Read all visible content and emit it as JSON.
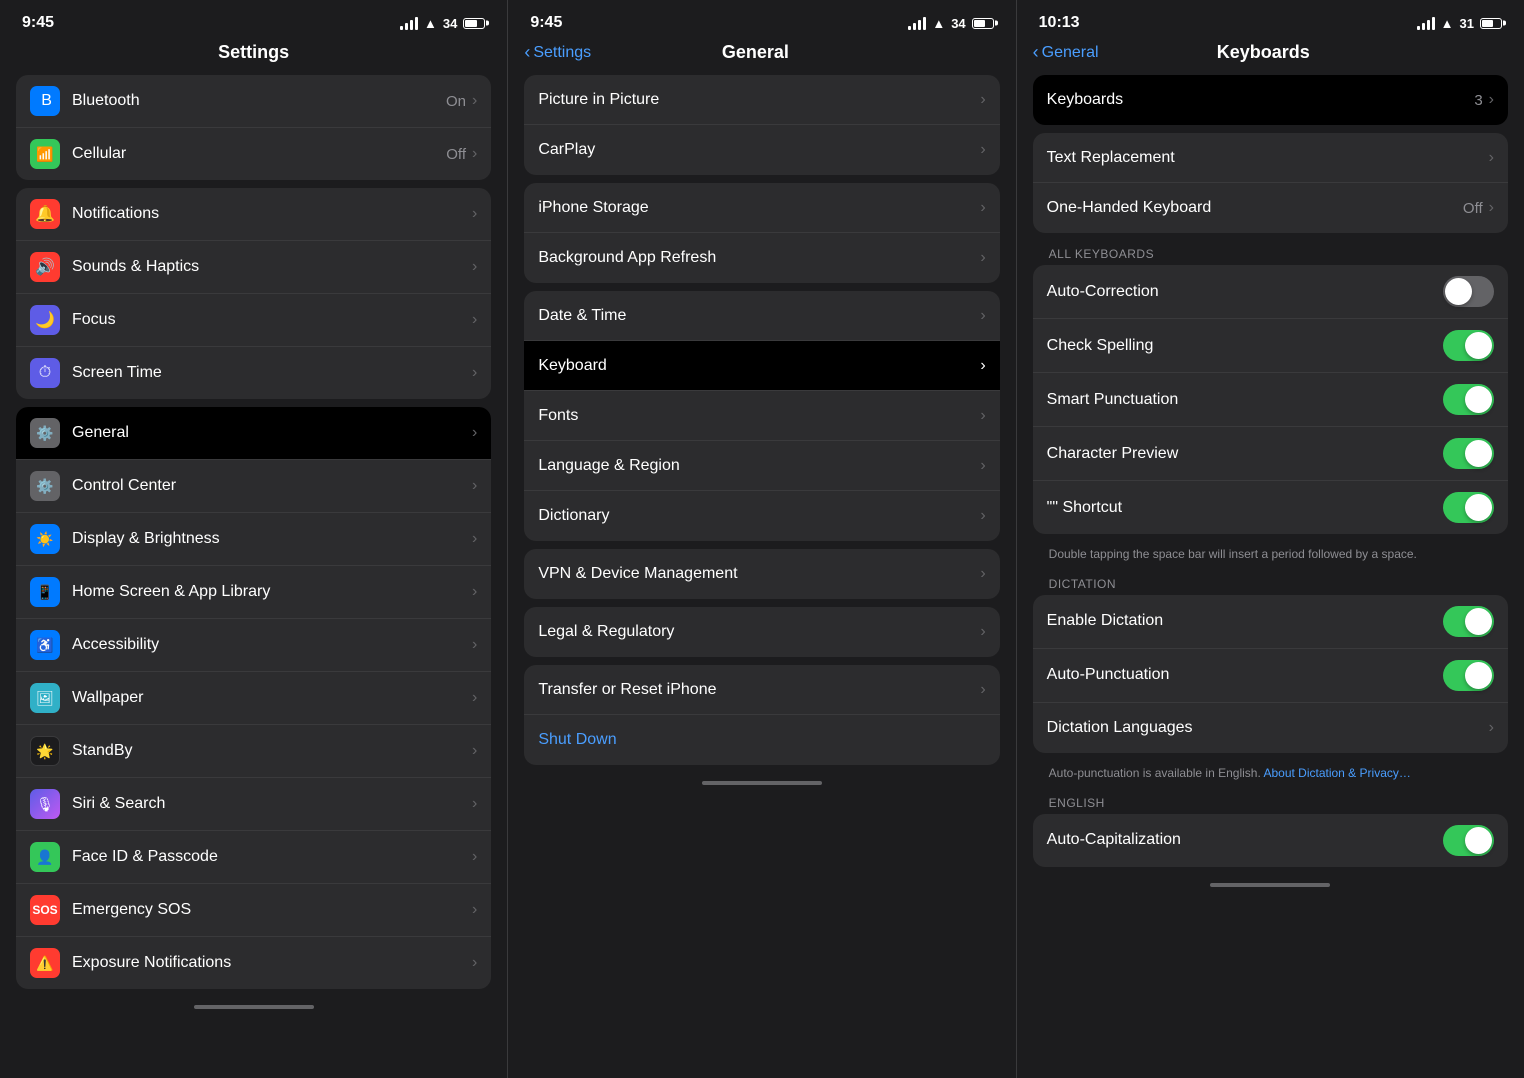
{
  "panels": [
    {
      "id": "settings",
      "statusBar": {
        "time": "9:45",
        "battery": "34"
      },
      "navTitle": "Settings",
      "groups": [
        {
          "items": [
            {
              "icon": "🔵",
              "iconBg": "icon-blue",
              "label": "Bluetooth",
              "value": "On",
              "chevron": true
            },
            {
              "icon": "📶",
              "iconBg": "icon-green",
              "label": "Cellular",
              "value": "Off",
              "chevron": true
            }
          ]
        },
        {
          "items": [
            {
              "icon": "🔔",
              "iconBg": "icon-red",
              "label": "Notifications",
              "value": "",
              "chevron": true
            },
            {
              "icon": "🔊",
              "iconBg": "icon-red",
              "label": "Sounds & Haptics",
              "value": "",
              "chevron": true
            },
            {
              "icon": "🌙",
              "iconBg": "icon-purple",
              "label": "Focus",
              "value": "",
              "chevron": true
            },
            {
              "icon": "⏱",
              "iconBg": "icon-purple",
              "label": "Screen Time",
              "value": "",
              "chevron": true
            }
          ]
        },
        {
          "items": [
            {
              "icon": "⚙️",
              "iconBg": "icon-gray",
              "label": "General",
              "value": "",
              "chevron": true,
              "selected": true
            },
            {
              "icon": "⚙️",
              "iconBg": "icon-gray",
              "label": "Control Center",
              "value": "",
              "chevron": true
            },
            {
              "icon": "☀️",
              "iconBg": "icon-blue",
              "label": "Display & Brightness",
              "value": "",
              "chevron": true
            },
            {
              "icon": "📱",
              "iconBg": "icon-blue",
              "label": "Home Screen & App Library",
              "value": "",
              "chevron": true
            },
            {
              "icon": "♿",
              "iconBg": "icon-blue",
              "label": "Accessibility",
              "value": "",
              "chevron": true
            },
            {
              "icon": "🖼",
              "iconBg": "icon-teal",
              "label": "Wallpaper",
              "value": "",
              "chevron": true
            },
            {
              "icon": "⏱",
              "iconBg": "icon-dark",
              "label": "StandBy",
              "value": "",
              "chevron": true
            },
            {
              "icon": "🎙",
              "iconBg": "icon-gradient-siri",
              "label": "Siri & Search",
              "value": "",
              "chevron": true
            },
            {
              "icon": "👤",
              "iconBg": "icon-green",
              "label": "Face ID & Passcode",
              "value": "",
              "chevron": true
            },
            {
              "icon": "🆘",
              "iconBg": "icon-red",
              "label": "Emergency SOS",
              "value": "",
              "chevron": true
            },
            {
              "icon": "⚠️",
              "iconBg": "icon-red",
              "label": "Exposure Notifications",
              "value": "",
              "chevron": true
            }
          ]
        }
      ]
    },
    {
      "id": "general",
      "statusBar": {
        "time": "9:45",
        "battery": "34"
      },
      "navBack": "Settings",
      "navTitle": "General",
      "groups": [
        {
          "items": [
            {
              "label": "Picture in Picture",
              "value": "",
              "chevron": true
            },
            {
              "label": "CarPlay",
              "value": "",
              "chevron": true
            }
          ]
        },
        {
          "items": [
            {
              "label": "iPhone Storage",
              "value": "",
              "chevron": true
            },
            {
              "label": "Background App Refresh",
              "value": "",
              "chevron": true
            }
          ]
        },
        {
          "items": [
            {
              "label": "Date & Time",
              "value": "",
              "chevron": true
            },
            {
              "label": "Keyboard",
              "value": "",
              "chevron": true,
              "selected": true
            },
            {
              "label": "Fonts",
              "value": "",
              "chevron": true
            },
            {
              "label": "Language & Region",
              "value": "",
              "chevron": true
            },
            {
              "label": "Dictionary",
              "value": "",
              "chevron": true
            }
          ]
        },
        {
          "items": [
            {
              "label": "VPN & Device Management",
              "value": "",
              "chevron": true
            }
          ]
        },
        {
          "items": [
            {
              "label": "Legal & Regulatory",
              "value": "",
              "chevron": true
            }
          ]
        },
        {
          "items": [
            {
              "label": "Transfer or Reset iPhone",
              "value": "",
              "chevron": true
            },
            {
              "label": "Shut Down",
              "value": "",
              "chevron": false,
              "isShutdown": true
            }
          ]
        }
      ]
    },
    {
      "id": "keyboards",
      "statusBar": {
        "time": "10:13",
        "battery": "31"
      },
      "navBack": "General",
      "navTitle": "Keyboards",
      "keyboardsCount": "3",
      "groups": [
        {
          "label": null,
          "items": [
            {
              "label": "Keyboards",
              "value": "3",
              "chevron": true,
              "isKeyboardsTitle": true
            }
          ]
        },
        {
          "label": null,
          "items": [
            {
              "label": "Text Replacement",
              "value": "",
              "chevron": true
            },
            {
              "label": "One-Handed Keyboard",
              "value": "Off",
              "chevron": true
            }
          ]
        },
        {
          "sectionLabel": "ALL KEYBOARDS",
          "items": [
            {
              "label": "Auto-Correction",
              "value": "",
              "toggle": true,
              "toggleOn": false
            },
            {
              "label": "Check Spelling",
              "value": "",
              "toggle": true,
              "toggleOn": true
            },
            {
              "label": "Smart Punctuation",
              "value": "",
              "toggle": true,
              "toggleOn": true
            },
            {
              "label": "Character Preview",
              "value": "",
              "toggle": true,
              "toggleOn": true
            },
            {
              "label": "\"\" Shortcut",
              "value": "",
              "toggle": true,
              "toggleOn": true
            }
          ],
          "note": "Double tapping the space bar will insert a period followed by a space."
        },
        {
          "sectionLabel": "DICTATION",
          "items": [
            {
              "label": "Enable Dictation",
              "value": "",
              "toggle": true,
              "toggleOn": true
            },
            {
              "label": "Auto-Punctuation",
              "value": "",
              "toggle": true,
              "toggleOn": true
            },
            {
              "label": "Dictation Languages",
              "value": "",
              "chevron": true
            }
          ],
          "note": "Auto-punctuation is available in English. About Dictation & Privacy…",
          "noteHasLink": true
        },
        {
          "sectionLabel": "ENGLISH",
          "items": [
            {
              "label": "Auto-Capitalization",
              "value": "",
              "toggle": true,
              "toggleOn": true
            }
          ]
        }
      ]
    }
  ]
}
